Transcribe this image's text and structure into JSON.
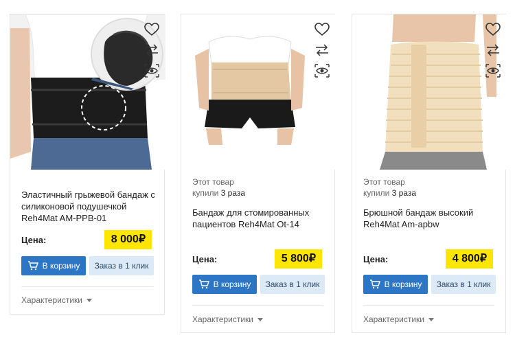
{
  "common": {
    "bought_prefix": "Этот товар",
    "bought_mid": "купили",
    "price_label": "Цена:",
    "cart_label": "В корзину",
    "quick_order_label": "Заказ в 1 клик",
    "specs_label": "Характеристики",
    "icons": [
      "heart-icon",
      "compare-icon",
      "eye-icon",
      "cart-icon",
      "caret-down-icon"
    ]
  },
  "products": [
    {
      "title": "Эластичный грыжевой бандаж с силиконовой подушечкой Reh4Mat AM-PPB-01",
      "price": "8 000₽"
    },
    {
      "bought_count": "3 раза",
      "title": "Бандаж для стомированных пациентов Reh4Mat Ot-14",
      "price": "5 800₽"
    },
    {
      "bought_count": "3 раза",
      "title": "Брюшной бандаж высокий Reh4Mat Am-apbw",
      "price": "4 800₽"
    }
  ],
  "colors": {
    "price_bg": "#ffe600",
    "cart_button": "#2d76c6",
    "quick_button": "#dce9f6"
  }
}
